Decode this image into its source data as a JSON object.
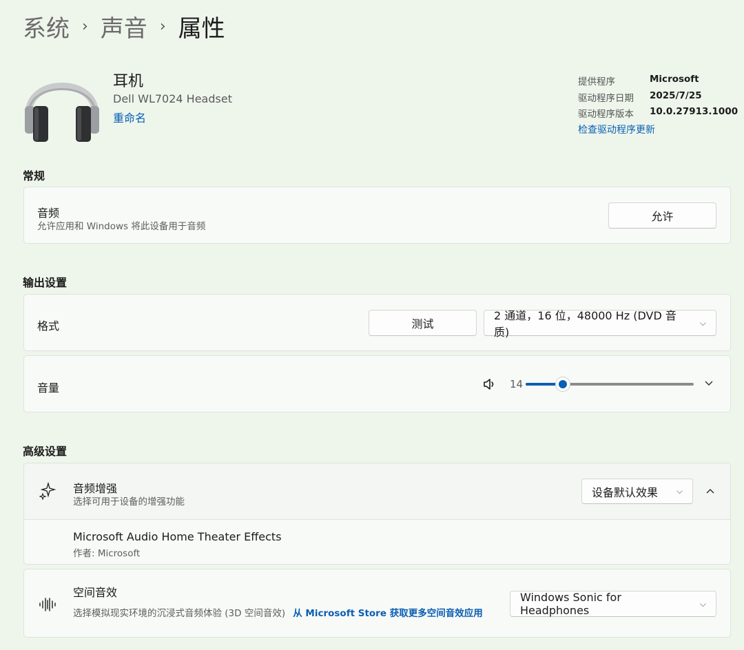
{
  "breadcrumb": {
    "items": [
      "系统",
      "声音"
    ],
    "current": "属性"
  },
  "device": {
    "title": "耳机",
    "model": "Dell WL7024 Headset",
    "rename": "重命名"
  },
  "driver": {
    "rows": [
      {
        "label": "提供程序",
        "value": "Microsoft"
      },
      {
        "label": "驱动程序日期",
        "value": "2025/7/25"
      },
      {
        "label": "驱动程序版本",
        "value": "10.0.27913.1000"
      }
    ],
    "update_link": "检查驱动程序更新"
  },
  "general": {
    "heading": "常规",
    "audio": {
      "title": "音频",
      "subtitle": "允许应用和 Windows 将此设备用于音频",
      "button": "允许"
    }
  },
  "output": {
    "heading": "输出设置",
    "format": {
      "title": "格式",
      "test_button": "测试",
      "selected": "2 通道，16 位，48000 Hz (DVD 音质)"
    },
    "volume": {
      "title": "音量",
      "value": "14",
      "level_percent": 14
    }
  },
  "advanced": {
    "heading": "高级设置",
    "enhance": {
      "title": "音频增强",
      "subtitle": "选择可用于设备的增强功能",
      "selected": "设备默认效果"
    },
    "effect": {
      "title": "Microsoft Audio Home Theater Effects",
      "author": "作者: Microsoft"
    },
    "spatial": {
      "title": "空间音效",
      "subtitle": "选择模拟现实环境的沉浸式音频体验 (3D 空间音效)",
      "store_link": "从 Microsoft Store 获取更多空间音效应用",
      "selected": "Windows Sonic for Headphones"
    }
  },
  "colors": {
    "accent": "#0a5fb4",
    "background": "#eef6ec",
    "card": "#f8faf7"
  },
  "icons": [
    "headphones-icon",
    "chevron-right-icon",
    "speaker-icon",
    "chevron-down-icon",
    "chevron-up-icon",
    "sparkle-icon",
    "spatial-audio-icon"
  ]
}
